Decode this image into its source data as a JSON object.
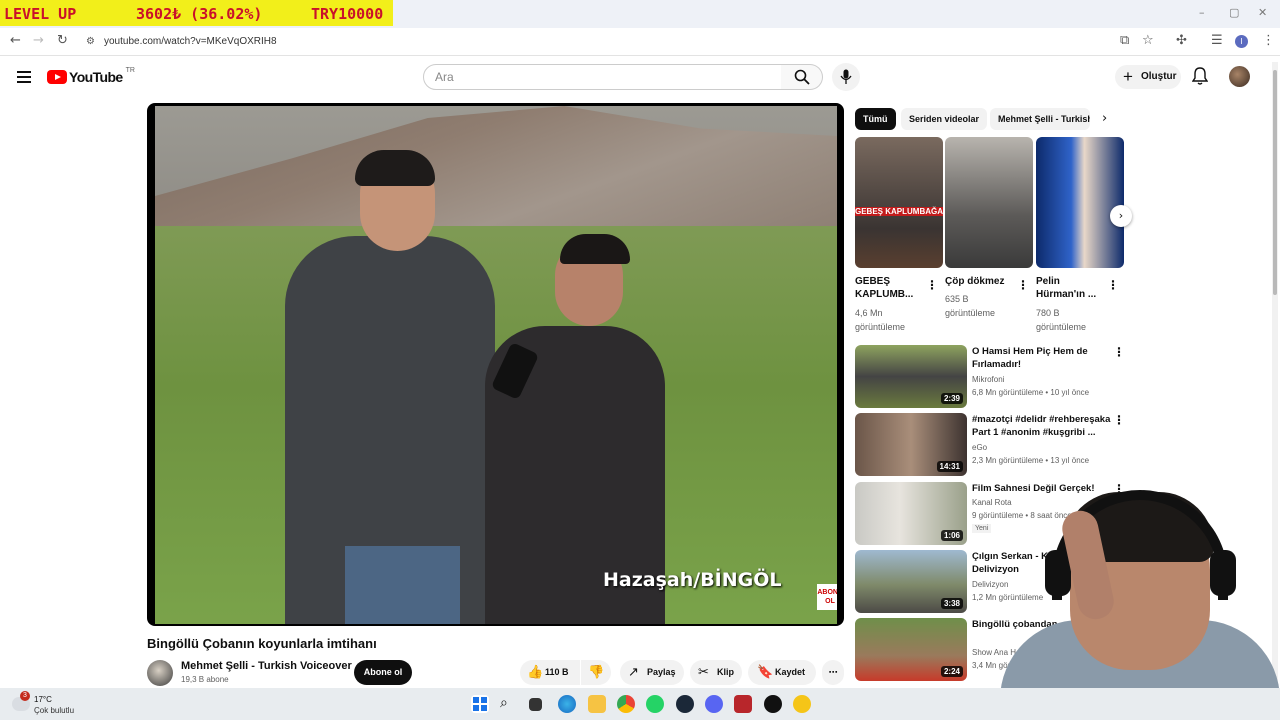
{
  "overlay": {
    "left": "LEVEL UP",
    "middle": "3602₺ (36.02%)",
    "right": "TRY10000"
  },
  "browser": {
    "url": "youtube.com/watch?v=MKeVqOXRIH8",
    "window_controls": [
      "–",
      "▢",
      "✕"
    ]
  },
  "header": {
    "logo_text": "YouTube",
    "country_code": "TR",
    "search_placeholder": "Ara",
    "create_label": "Oluştur"
  },
  "video": {
    "caption_overlay": "Hazaşah/BİNGÖL",
    "logo_overlay": "ABONE OL",
    "title": "Bingöllü Çobanın koyunlarla imtihanı",
    "channel": "Mehmet Şelli - Turkish Voiceover",
    "subscribers": "19,3 B abone",
    "subscribe_label": "Abone ol",
    "likes": "110 B",
    "share_label": "Paylaş",
    "clip_label": "Klip",
    "save_label": "Kaydet"
  },
  "chips": [
    "Tümü",
    "Seriden videolar",
    "Mehmet Şelli - Turkish"
  ],
  "shorts": [
    {
      "title": "GEBEŞ KAPLUMB...",
      "views": "4,6 Mn",
      "views_suffix": "görüntüleme",
      "overlay": "GEBEŞ KAPLUMBAĞA"
    },
    {
      "title": "Çöp dökmez",
      "views": "635 B",
      "views_suffix": "görüntüleme",
      "overlay": ""
    },
    {
      "title": "Pelin Hürman'ın ...",
      "views": "780 B",
      "views_suffix": "görüntüleme",
      "overlay": ""
    }
  ],
  "recommended": [
    {
      "title": "O Hamsi Hem Piç Hem de Fırlamadır!",
      "channel": "Mikrofoni",
      "meta": "6,8 Mn görüntüleme • 10 yıl önce",
      "duration": "2:39",
      "badge": ""
    },
    {
      "title": "#mazotçi #delidr #rehbereşaka Part 1 #anonim #kuşgribi ...",
      "channel": "eGo",
      "meta": "2,3 Mn görüntüleme • 13 yıl önce",
      "duration": "14:31",
      "badge": ""
    },
    {
      "title": "Film Sahnesi Değil Gerçek!",
      "channel": "Kanal Rota",
      "meta": "9 görüntüleme • 8 saat önce",
      "duration": "1:06",
      "badge": "Yeni"
    },
    {
      "title": "Çılgın Serkan - Kıyam... Sana | Delivizyon",
      "channel": "Delivizyon",
      "meta": "1,2 Mn görüntüleme",
      "duration": "3:38",
      "badge": ""
    },
    {
      "title": "Bingöllü çobandan ... deneme",
      "channel": "Show Ana Ha...",
      "meta": "3,4 Mn görün...",
      "duration": "2:24",
      "badge": ""
    }
  ],
  "taskbar": {
    "temperature": "17°C",
    "weather": "Çok bulutlu",
    "notification_count": "3"
  }
}
